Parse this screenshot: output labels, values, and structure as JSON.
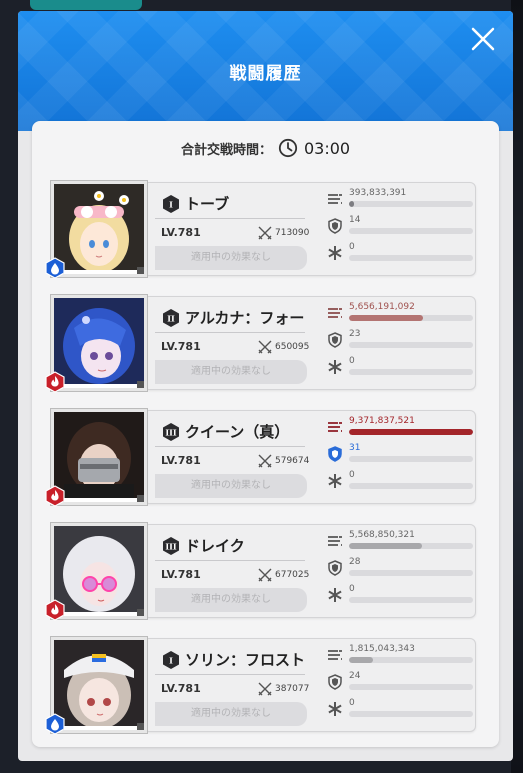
{
  "dialog": {
    "title": "戦闘履歴",
    "total_time_label": "合計交戦時間：",
    "total_time_value": "03:00"
  },
  "units": [
    {
      "rank": "I",
      "name": "トーブ",
      "level": "LV.781",
      "power": "713090",
      "effect": "適用中の効果なし",
      "element": "water",
      "damage": "393,833,391",
      "damage_ratio": 0.04,
      "damage_color": "#7d7d82",
      "damage_icon_color": "#555",
      "shield": "14",
      "shield_ratio": 0,
      "shield_highlight": false,
      "heal": "0",
      "heal_ratio": 0
    },
    {
      "rank": "II",
      "name": "アルカナ：フォー",
      "level": "LV.781",
      "power": "650095",
      "effect": "適用中の効果なし",
      "element": "fire",
      "damage": "5,656,191,092",
      "damage_ratio": 0.6,
      "damage_color": "#b37472",
      "damage_icon_color": "#8a4a4a",
      "shield": "23",
      "shield_ratio": 0,
      "shield_highlight": false,
      "heal": "0",
      "heal_ratio": 0
    },
    {
      "rank": "III",
      "name": "クイーン（真）",
      "level": "LV.781",
      "power": "579674",
      "effect": "適用中の効果なし",
      "element": "fire",
      "damage": "9,371,837,521",
      "damage_ratio": 1.0,
      "damage_color": "#a3252a",
      "damage_icon_color": "#8f1d24",
      "shield": "31",
      "shield_ratio": 0,
      "shield_highlight": true,
      "heal": "0",
      "heal_ratio": 0
    },
    {
      "rank": "III",
      "name": "ドレイク",
      "level": "LV.781",
      "power": "677025",
      "effect": "適用中の効果なし",
      "element": "fire",
      "damage": "5,568,850,321",
      "damage_ratio": 0.59,
      "damage_color": "#a8a8ab",
      "damage_icon_color": "#555",
      "shield": "28",
      "shield_ratio": 0,
      "shield_highlight": false,
      "heal": "0",
      "heal_ratio": 0
    },
    {
      "rank": "I",
      "name": "ソリン：フロスト",
      "level": "LV.781",
      "power": "387077",
      "effect": "適用中の効果なし",
      "element": "water",
      "damage": "1,815,043,343",
      "damage_ratio": 0.19,
      "damage_color": "#a8a8ab",
      "damage_icon_color": "#555",
      "shield": "24",
      "shield_ratio": 0,
      "shield_highlight": false,
      "heal": "0",
      "heal_ratio": 0
    }
  ],
  "colors": {
    "header_blue": "#1a84e6",
    "water": "#1c5fd6",
    "fire": "#c8202a"
  }
}
